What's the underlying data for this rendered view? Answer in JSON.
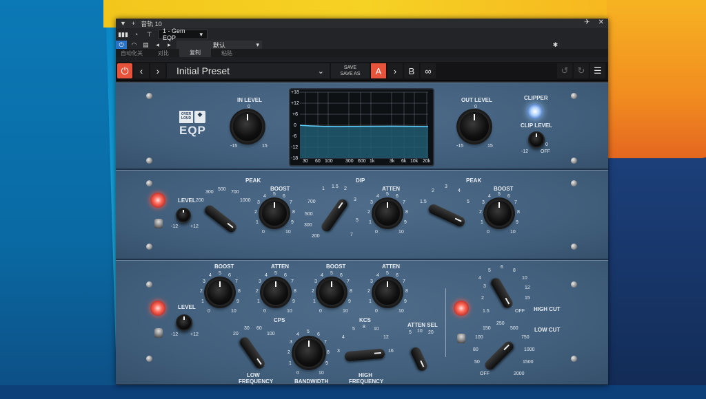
{
  "window": {
    "title": "音轨 10",
    "plugin_slot": "1 - Gem EQP",
    "preset_label": "默认",
    "tabs": [
      "自动化关",
      "对比",
      "复制",
      "粘贴"
    ]
  },
  "toolbar": {
    "preset_name": "Initial Preset",
    "save": "SAVE",
    "save_as": "SAVE AS",
    "a": "A",
    "b": "B"
  },
  "top_panel": {
    "in_level": "IN LEVEL",
    "in_zero": "0",
    "in_min": "-15",
    "in_max": "15",
    "out_level": "OUT LEVEL",
    "out_zero": "0",
    "out_min": "-15",
    "out_max": "15",
    "clipper": "CLIPPER",
    "clip_level": "CLIP LEVEL",
    "clip_min": "-12",
    "clip_zero": "0",
    "clip_off": "OFF",
    "logo_line1": "OVER",
    "logo_line2": "LOUD",
    "logo_name": "EQP",
    "scope_db": [
      "+18",
      "+12",
      "+6",
      "0",
      "-6",
      "-12",
      "-18"
    ],
    "scope_freq": [
      "30",
      "60",
      "100",
      "300",
      "600",
      "1k",
      "3k",
      "6k",
      "10k",
      "20k"
    ]
  },
  "mid_panel": {
    "peak1": "PEAK",
    "level": "LEVEL",
    "level_min": "-12",
    "level_max": "+12",
    "peak1_freqs": [
      "200",
      "300",
      "500",
      "700",
      "1000"
    ],
    "boost": "BOOST",
    "dial_0_10": [
      "0",
      "1",
      "2",
      "3",
      "4",
      "5",
      "6",
      "7",
      "8",
      "9",
      "10"
    ],
    "dip": "DIP",
    "dip_freqs": [
      "200",
      "300",
      "500",
      "700",
      "1",
      "1.5",
      "2",
      "3",
      "5",
      "7"
    ],
    "atten": "ATTEN",
    "peak2": "PEAK",
    "peak2_freqs": [
      "1.5",
      "2",
      "3",
      "4",
      "5"
    ],
    "boost2": "BOOST"
  },
  "bottom_panel": {
    "boost_a": "BOOST",
    "atten_a": "ATTEN",
    "boost_b": "BOOST",
    "atten_b": "ATTEN",
    "level": "LEVEL",
    "level_min": "-12",
    "level_max": "+12",
    "cps": "CPS",
    "cps_vals": [
      "20",
      "30",
      "60",
      "100"
    ],
    "low_frequency_1": "LOW",
    "low_frequency_2": "FREQUENCY",
    "bandwidth": "BANDWIDTH",
    "kcs": "KCS",
    "kcs_vals": [
      "3",
      "4",
      "5",
      "8",
      "10",
      "12",
      "16"
    ],
    "high_frequency_1": "HIGH",
    "high_frequency_2": "FREQUENCY",
    "atten_sel": "ATTEN SEL",
    "atten_sel_vals": [
      "5",
      "10",
      "20"
    ],
    "high_cut": "HIGH CUT",
    "high_cut_vals": [
      "1.5",
      "2",
      "3",
      "4",
      "5",
      "6",
      "8",
      "10",
      "12",
      "15",
      "OFF"
    ],
    "low_cut": "LOW CUT",
    "low_cut_vals": [
      "OFF",
      "50",
      "80",
      "100",
      "150",
      "250",
      "500",
      "750",
      "1000",
      "1500",
      "2000"
    ]
  }
}
